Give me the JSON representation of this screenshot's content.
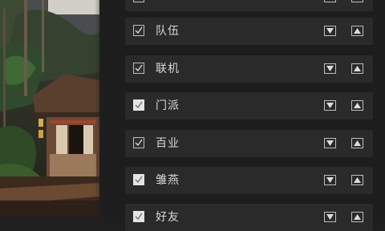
{
  "panel": {
    "items": [
      {
        "label": "",
        "checked": true,
        "highlight": false
      },
      {
        "label": "队伍",
        "checked": true,
        "highlight": false
      },
      {
        "label": "联机",
        "checked": true,
        "highlight": false
      },
      {
        "label": "门派",
        "checked": true,
        "highlight": true
      },
      {
        "label": "百业",
        "checked": true,
        "highlight": false
      },
      {
        "label": "雏燕",
        "checked": true,
        "highlight": true
      },
      {
        "label": "好友",
        "checked": true,
        "highlight": true
      }
    ],
    "move_down_icon": "triangle-down-icon",
    "move_up_icon": "triangle-up-icon"
  },
  "colors": {
    "panel_bg": "#1d1d1d",
    "row_bg": "#2a2a2a",
    "text": "#d8d8d8",
    "border": "#bdbdbd"
  }
}
